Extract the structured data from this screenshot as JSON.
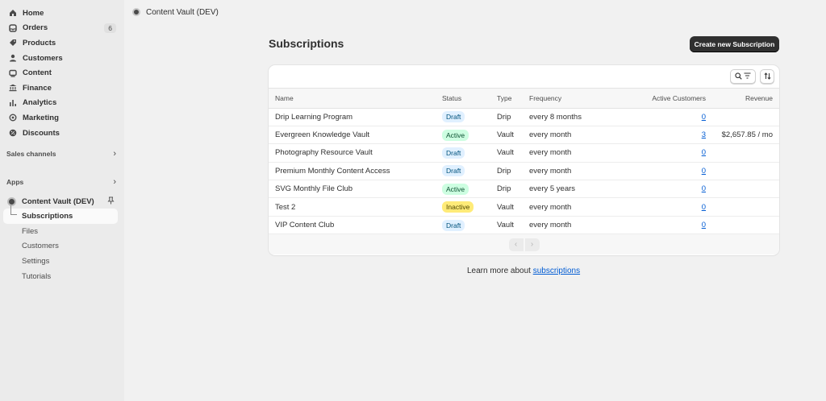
{
  "sidebar": {
    "nav": [
      {
        "label": "Home",
        "icon": "home-icon"
      },
      {
        "label": "Orders",
        "icon": "orders-icon",
        "badge": "6"
      },
      {
        "label": "Products",
        "icon": "tag-icon"
      },
      {
        "label": "Customers",
        "icon": "person-icon"
      },
      {
        "label": "Content",
        "icon": "content-icon"
      },
      {
        "label": "Finance",
        "icon": "bank-icon"
      },
      {
        "label": "Analytics",
        "icon": "bar-chart-icon"
      },
      {
        "label": "Marketing",
        "icon": "target-icon"
      },
      {
        "label": "Discounts",
        "icon": "discount-icon"
      }
    ],
    "sales_channels_label": "Sales channels",
    "apps_label": "Apps",
    "app_name": "Content Vault (DEV)",
    "app_sub_items": [
      "Subscriptions",
      "Files",
      "Customers",
      "Settings",
      "Tutorials"
    ]
  },
  "topbar": {
    "title": "Content Vault (DEV)"
  },
  "page": {
    "title": "Subscriptions",
    "create_button": "Create new Subscription",
    "learn_prefix": "Learn more about ",
    "learn_link": "subscriptions"
  },
  "table": {
    "headers": {
      "name": "Name",
      "status": "Status",
      "type": "Type",
      "frequency": "Frequency",
      "customers": "Active Customers",
      "revenue": "Revenue"
    },
    "rows": [
      {
        "name": "Drip Learning Program",
        "status": "Draft",
        "type": "Drip",
        "frequency": "every 8 months",
        "customers": "0",
        "revenue": ""
      },
      {
        "name": "Evergreen Knowledge Vault",
        "status": "Active",
        "type": "Vault",
        "frequency": "every month",
        "customers": "3",
        "revenue": "$2,657.85 / mo"
      },
      {
        "name": "Photography Resource Vault",
        "status": "Draft",
        "type": "Vault",
        "frequency": "every month",
        "customers": "0",
        "revenue": ""
      },
      {
        "name": "Premium Monthly Content Access",
        "status": "Draft",
        "type": "Drip",
        "frequency": "every month",
        "customers": "0",
        "revenue": ""
      },
      {
        "name": "SVG Monthly File Club",
        "status": "Active",
        "type": "Drip",
        "frequency": "every 5 years",
        "customers": "0",
        "revenue": ""
      },
      {
        "name": "Test 2",
        "status": "Inactive",
        "type": "Vault",
        "frequency": "every month",
        "customers": "0",
        "revenue": ""
      },
      {
        "name": "VIP Content Club",
        "status": "Draft",
        "type": "Vault",
        "frequency": "every month",
        "customers": "0",
        "revenue": ""
      }
    ]
  },
  "colors": {
    "primary_button": "#303030",
    "link": "#005bd3",
    "draft": "#e0f0ff",
    "active": "#cdfee1",
    "inactive": "#ffeb78"
  }
}
